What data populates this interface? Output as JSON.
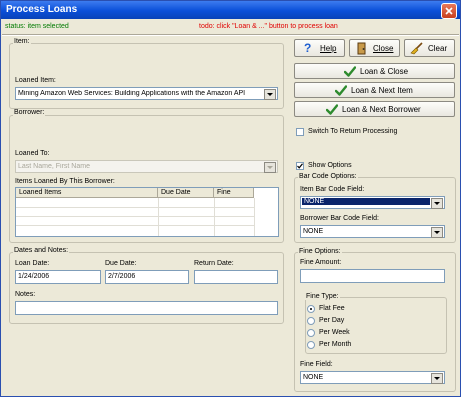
{
  "window": {
    "title": "Process Loans"
  },
  "status": {
    "text": "status: item selected"
  },
  "todo": {
    "text": "todo: click \"Loan & ...\" button to process loan"
  },
  "item_group": {
    "label": "Item:",
    "loaned_item_label": "Loaned Item:",
    "loaned_item_value": "Mining Amazon Web Services: Building Applications with the Amazon API"
  },
  "borrower_group": {
    "label": "Borrower:",
    "loaned_to_label": "Loaned To:",
    "loaned_to_placeholder": "Last Name, First Name",
    "items_loaned_label": "Items Loaned By This Borrower:",
    "columns": [
      "Loaned Items",
      "Due Date",
      "Fine"
    ]
  },
  "dates_group": {
    "label": "Dates and Notes:",
    "loan_date_label": "Loan Date:",
    "loan_date_value": "1/24/2006",
    "due_date_label": "Due Date:",
    "due_date_value": "2/7/2006",
    "return_date_label": "Return Date:",
    "return_date_value": "",
    "notes_label": "Notes:",
    "notes_value": ""
  },
  "toolbar": {
    "help": "Help",
    "close": "Close",
    "clear": "Clear"
  },
  "actions": {
    "loan_close": "Loan & Close",
    "loan_next_item": "Loan & Next Item",
    "loan_next_borrower": "Loan & Next Borrower"
  },
  "switch_return": {
    "label": "Switch To Return Processing",
    "checked": false
  },
  "show_options": {
    "label": "Show Options",
    "checked": true
  },
  "barcode_options": {
    "label": "Bar Code Options:",
    "item_field_label": "Item Bar Code Field:",
    "item_field_value": "NONE",
    "borrower_field_label": "Borrower Bar Code Field:",
    "borrower_field_value": "NONE"
  },
  "fine_options": {
    "label": "Fine Options:",
    "fine_amount_label": "Fine Amount:",
    "fine_amount_value": "",
    "fine_type_label": "Fine Type:",
    "fine_types": [
      "Flat Fee",
      "Per Day",
      "Per Week",
      "Per Month"
    ],
    "selected_fine_type": "Flat Fee",
    "fine_field_label": "Fine Field:",
    "fine_field_value": "NONE"
  },
  "colors": {
    "status": "#007a00",
    "todo": "#e00000",
    "check": "#2e8b2e",
    "titlebar": "#0a4fd8"
  },
  "icons": {
    "help": "question-icon",
    "close": "door-icon",
    "clear": "broom-icon",
    "action": "checkmark-icon"
  }
}
